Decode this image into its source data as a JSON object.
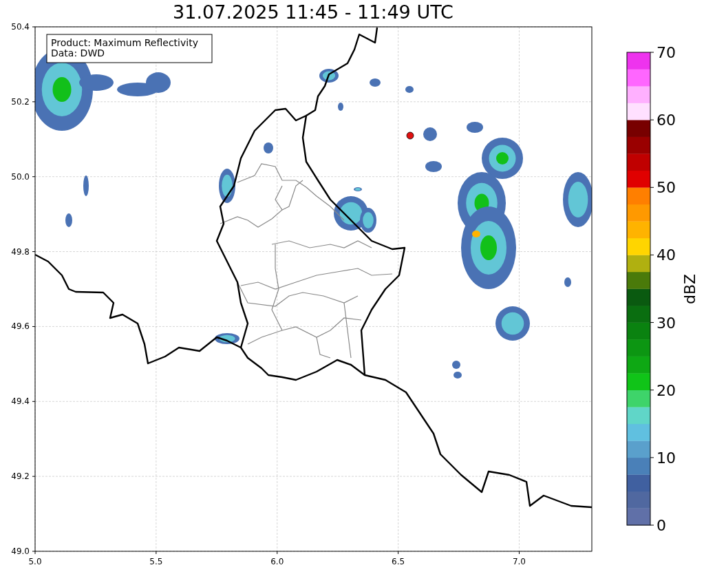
{
  "title": "31.07.2025 11:45 - 11:49 UTC",
  "annotation": [
    "Product: Maximum Reflectivity",
    "Data: DWD"
  ],
  "x_ticks": [
    "5.0",
    "5.5",
    "6.0",
    "6.5",
    "7.0"
  ],
  "y_ticks": [
    "50.4",
    "50.2",
    "50.0",
    "49.8",
    "49.6",
    "49.4",
    "49.2",
    "49.0"
  ],
  "colorbar": {
    "label": "dBZ",
    "ticks": [
      "70",
      "60",
      "50",
      "40",
      "30",
      "20",
      "10",
      "0"
    ],
    "segments": [
      {
        "color": "#6070a8"
      },
      {
        "color": "#5068a0"
      },
      {
        "color": "#4060a0"
      },
      {
        "color": "#4a80b8"
      },
      {
        "color": "#5aa0cc"
      },
      {
        "color": "#60c0e0"
      },
      {
        "color": "#60d6c8"
      },
      {
        "color": "#3ed46a"
      },
      {
        "color": "#10c418"
      },
      {
        "color": "#0ea814"
      },
      {
        "color": "#0c9612"
      },
      {
        "color": "#0a8210"
      },
      {
        "color": "#0a6e10"
      },
      {
        "color": "#0a5a10"
      },
      {
        "color": "#4a7a0a"
      },
      {
        "color": "#b0b010"
      },
      {
        "color": "#ffd500"
      },
      {
        "color": "#ffb300"
      },
      {
        "color": "#ff9900"
      },
      {
        "color": "#ff7f00"
      },
      {
        "color": "#e00000"
      },
      {
        "color": "#c00000"
      },
      {
        "color": "#9a0000"
      },
      {
        "color": "#780000"
      },
      {
        "color": "#ffe0ff"
      },
      {
        "color": "#ffb0ff"
      },
      {
        "color": "#ff66ff"
      },
      {
        "color": "#ee33ee"
      }
    ]
  }
}
